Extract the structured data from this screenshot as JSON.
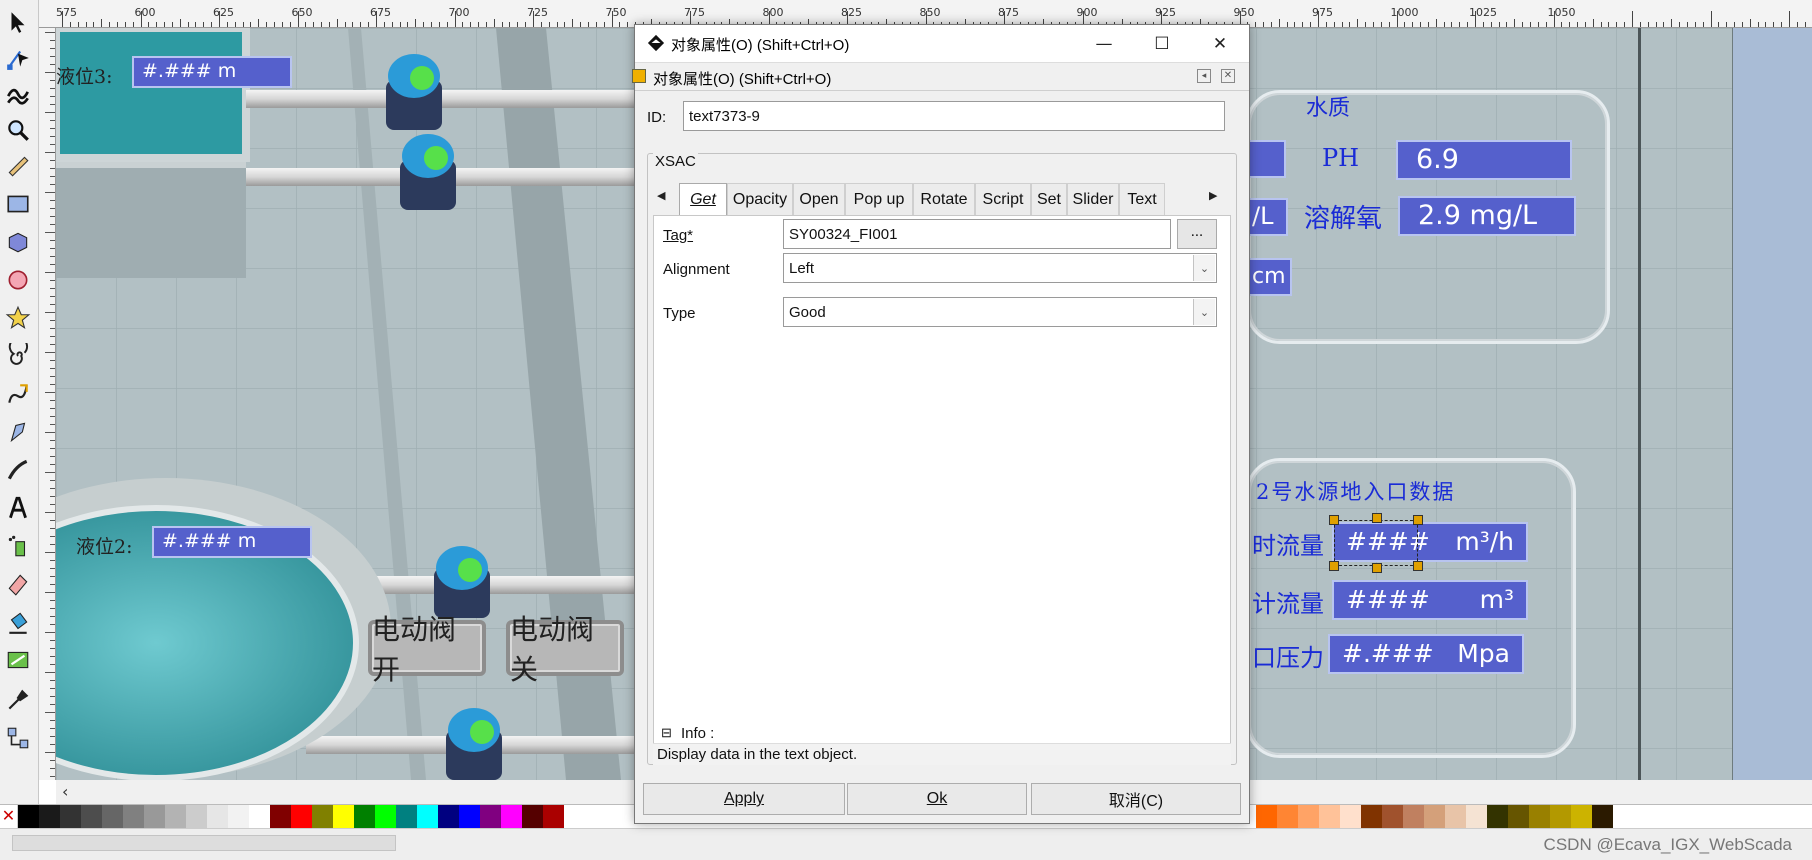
{
  "ruler": {
    "labels": [
      "575",
      "600",
      "625",
      "650",
      "675",
      "700",
      "725",
      "750",
      "775",
      "800",
      "825",
      "850",
      "875",
      "900",
      "925",
      "950",
      "975",
      "1000",
      "1025",
      "1050"
    ]
  },
  "canvas": {
    "liquid3": {
      "label": "液位3:",
      "value": "#.### m"
    },
    "liquid2": {
      "label": "液位2:",
      "value": "#.### m"
    },
    "buttons": {
      "open": "电动阀开",
      "close": "电动阀关"
    },
    "quality": {
      "title": "水质",
      "ph_label": "PH",
      "ph_value": "6.9",
      "do_label": "溶解氧",
      "do_value": "2.9 mg/L",
      "partial_unit": "/L",
      "partial_cm": "cm"
    },
    "source2": {
      "title": "2号水源地入口数据",
      "row1_label": "时流量",
      "row1_value": "####",
      "row1_unit": "m³/h",
      "row2_label": "计流量",
      "row2_value": "####",
      "row2_unit": "m³",
      "row3_label": "口压力",
      "row3_value": "#.###",
      "row3_unit": "Mpa"
    }
  },
  "dialog": {
    "title": "对象属性(O) (Shift+Ctrl+O)",
    "subtitle": "对象属性(O) (Shift+Ctrl+O)",
    "id_label": "ID:",
    "id_value": "text7373-9",
    "group_label": "XSAC",
    "tabs": [
      "Get",
      "Opacity",
      "Open",
      "Pop up",
      "Rotate",
      "Script",
      "Set",
      "Slider",
      "Text"
    ],
    "tag_label": "Tag*",
    "tag_value": "SY00324_FI001",
    "browse_label": "...",
    "alignment_label": "Alignment",
    "alignment_value": "Left",
    "type_label": "Type",
    "type_value": "Good",
    "info_toggle": "⊟",
    "info_label": "Info :",
    "info_text": "Display data in the text object.",
    "apply": "Apply",
    "ok": "Ok",
    "cancel": "取消(C)"
  },
  "watermark": "CSDN @Ecava_IGX_WebScada",
  "palette_colors": [
    "#000000",
    "#1a1a1a",
    "#333333",
    "#4d4d4d",
    "#666666",
    "#808080",
    "#999999",
    "#b3b3b3",
    "#cccccc",
    "#e6e6e6",
    "#f2f2f2",
    "#ffffff",
    "#800000",
    "#ff0000",
    "#808000",
    "#ffff00",
    "#008000",
    "#00ff00",
    "#008080",
    "#00ffff",
    "#000080",
    "#0000ff",
    "#800080",
    "#ff00ff",
    "#550000",
    "#aa0000"
  ],
  "palette_right": [
    "#ff6600",
    "#ff8533",
    "#ffa366",
    "#ffc299",
    "#ffe0cc",
    "#803300",
    "#a0522d",
    "#c08060",
    "#d4a07a",
    "#e8c4a8",
    "#f5e3d3",
    "#333300",
    "#665500",
    "#998000",
    "#b39900",
    "#ccb300",
    "#2b1a00"
  ]
}
